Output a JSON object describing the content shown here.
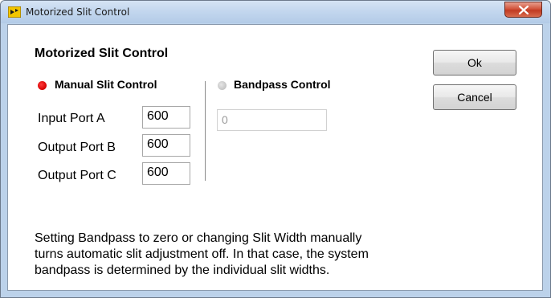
{
  "window": {
    "title": "Motorized Slit Control"
  },
  "dialog": {
    "heading": "Motorized Slit Control",
    "manual_radio_label": "Manual Slit Control",
    "bandpass_radio_label": "Bandpass Control",
    "ports": [
      {
        "label": "Input Port A",
        "value": "600"
      },
      {
        "label": "Output Port B",
        "value": "600"
      },
      {
        "label": "Output Port C",
        "value": "600"
      }
    ],
    "bandpass_value": "0",
    "ok_label": "Ok",
    "cancel_label": "Cancel",
    "info_lines": [
      "Setting Bandpass to zero or changing Slit Width manually",
      "turns automatic slit adjustment off.  In that case, the system",
      "bandpass is determined  by the individual slit widths."
    ]
  },
  "colors": {
    "selected_radio": "#e00000",
    "unselected_radio": "#c8c8c8",
    "close_button": "#c9432a"
  },
  "icons": {
    "app": "labview-app-icon",
    "close": "close-x-icon"
  }
}
